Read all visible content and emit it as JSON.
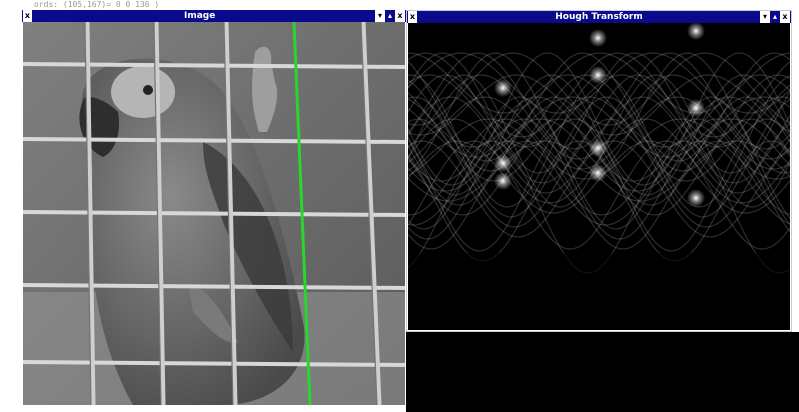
{
  "status_line": "ords: (105,167)= 0 0 136 )",
  "windows": {
    "image": {
      "title": "Image",
      "btn_left": "x",
      "btn_shade": "▾",
      "btn_max": "▴",
      "btn_close": "x"
    },
    "hough": {
      "title": "Hough Transform",
      "btn_left": "x",
      "btn_shade": "▾",
      "btn_max": "▴",
      "btn_close": "x"
    }
  },
  "colors": {
    "titlebar": "#0a0a8c",
    "detected_line": "#2bd62b"
  },
  "icons": [
    "pin-icon",
    "shade-icon",
    "maximize-icon",
    "close-icon"
  ]
}
